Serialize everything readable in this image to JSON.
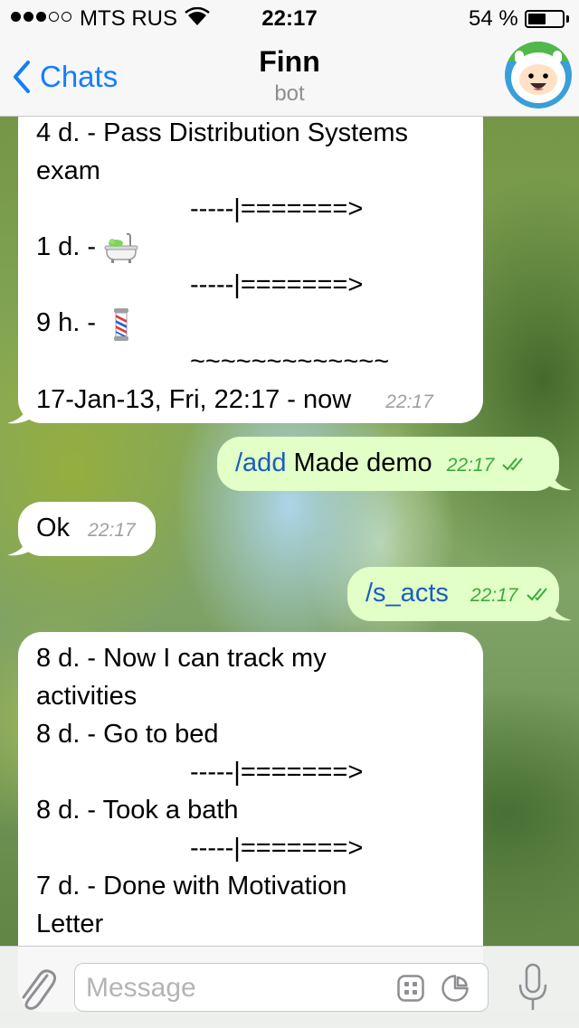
{
  "status_bar": {
    "carrier": "MTS RUS",
    "time": "22:17",
    "battery": "54 %",
    "battery_level": 0.54,
    "signal_bars_filled": 3,
    "signal_bars_total": 5
  },
  "header": {
    "back_label": "Chats",
    "title": "Finn",
    "subtitle": "bot"
  },
  "messages": [
    {
      "direction": "incoming",
      "lines": [
        "4 d. - Pass Distribution Systems",
        "exam",
        "-----|=======>",
        "1 d. -",
        "-----|=======>",
        "9 h. -",
        "~~~~~~~~~~~~~",
        "17-Jan-13, Fri, 22:17 - now"
      ],
      "time": "22:17"
    },
    {
      "direction": "outgoing",
      "command": "/add",
      "text": "Made demo",
      "time": "22:17"
    },
    {
      "direction": "incoming",
      "text": "Ok",
      "time": "22:17"
    },
    {
      "direction": "outgoing",
      "command": "/s_acts",
      "text": "",
      "time": "22:17"
    },
    {
      "direction": "incoming",
      "lines": [
        "8 d. - Now I can track my",
        "activities",
        "8 d. - Go to bed",
        "-----|=======>",
        "8 d. - Took a bath",
        "-----|=======>",
        "7 d. - Done with Motivation",
        "Letter"
      ]
    }
  ],
  "input": {
    "placeholder": "Message"
  },
  "colors": {
    "accent": "#147efb",
    "outgoing_bubble": "#e1ffc7",
    "incoming_bubble": "#ffffff",
    "read_check": "#3caa3c",
    "command_link": "#1a5dbf"
  },
  "icons": [
    "back-chevron-icon",
    "wifi-icon",
    "battery-icon",
    "bathtub-emoji-icon",
    "barber-pole-emoji-icon",
    "double-check-icon",
    "paperclip-icon",
    "keyboard-icon",
    "sticker-icon",
    "microphone-icon"
  ]
}
